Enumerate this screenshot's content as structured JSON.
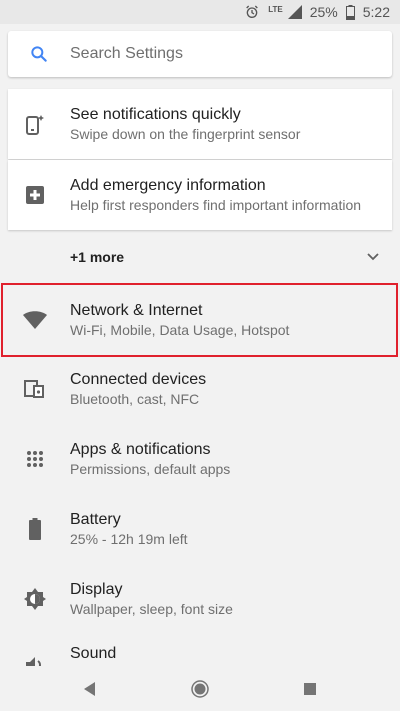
{
  "status_bar": {
    "network_label": "LTE",
    "battery": "25%",
    "time": "5:22",
    "icons": [
      "alarm-icon",
      "signal-icon",
      "battery-icon"
    ]
  },
  "search": {
    "placeholder": "Search Settings",
    "icon": "search-icon",
    "accent": "#4285f4"
  },
  "suggestions": [
    {
      "title": "See notifications quickly",
      "subtitle": "Swipe down on the fingerprint sensor",
      "icon": "fingerprint-swipe-icon"
    },
    {
      "title": "Add emergency information",
      "subtitle": "Help first responders find important information",
      "icon": "emergency-plus-icon"
    }
  ],
  "more": {
    "label": "+1 more",
    "icon": "chevron-down-icon"
  },
  "settings": [
    {
      "title": "Network & Internet",
      "subtitle": "Wi-Fi, Mobile, Data Usage, Hotspot",
      "icon": "wifi-icon",
      "highlighted": true
    },
    {
      "title": "Connected devices",
      "subtitle": "Bluetooth, cast, NFC",
      "icon": "devices-icon"
    },
    {
      "title": "Apps & notifications",
      "subtitle": "Permissions, default apps",
      "icon": "apps-grid-icon"
    },
    {
      "title": "Battery",
      "subtitle": "25% - 12h 19m left",
      "icon": "battery-icon"
    },
    {
      "title": "Display",
      "subtitle": "Wallpaper, sleep, font size",
      "icon": "brightness-icon"
    },
    {
      "title": "Sound",
      "subtitle": "",
      "icon": "volume-icon"
    }
  ],
  "colors": {
    "highlight_border": "#e0202d",
    "icon_gray": "#616161",
    "background": "#f2f2f2"
  },
  "nav": [
    "back-icon",
    "home-icon",
    "recents-icon"
  ]
}
